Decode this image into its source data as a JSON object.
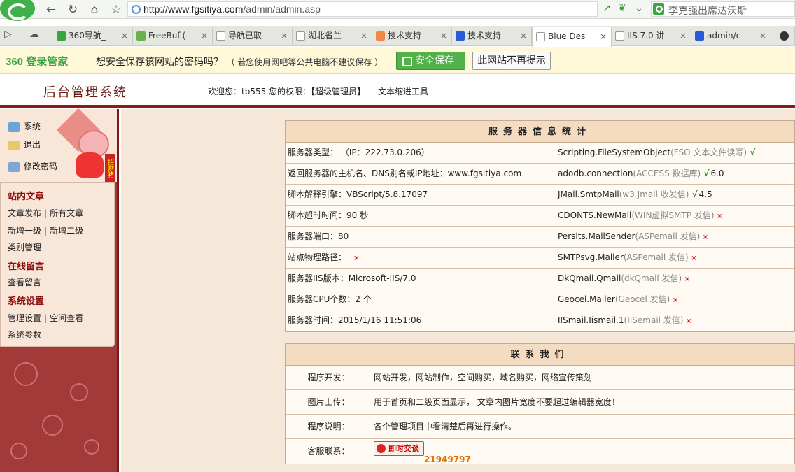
{
  "browser": {
    "url_prefix": "http://www.fgsitiya.com",
    "url_path": "/admin/admin.asp",
    "search_text": "李克强出席达沃斯",
    "tabs": [
      {
        "label": "360导航_",
        "icon_color": "#3aa640"
      },
      {
        "label": "FreeBuf.(",
        "icon_color": "#6ab04c"
      },
      {
        "label": "导航已取",
        "icon_color": "#ffffff"
      },
      {
        "label": "湖北省兰",
        "icon_color": "#ffffff"
      },
      {
        "label": "技术支持",
        "icon_color": "#e84"
      },
      {
        "label": "技术支持",
        "icon_color": "#2a5bd7"
      },
      {
        "label": "Blue Des",
        "icon_color": "#ffffff"
      },
      {
        "label": "IIS 7.0 讲",
        "icon_color": "#ffffff"
      },
      {
        "label": "admin/c",
        "icon_color": "#2a5bd7"
      }
    ]
  },
  "savebar": {
    "logo": "360 登录管家",
    "message": "想安全保存该网站的密码吗？",
    "note": "（ 若您使用网吧等公共电脑不建议保存 ）",
    "save_label": "安全保存",
    "never_label": "此网站不再提示"
  },
  "header": {
    "title": "后台管理系统",
    "welcome": "欢迎您：tb555  您的权限：【超级管理员】",
    "tool": "文本缩进工具"
  },
  "sidebar": {
    "top_links": [
      "系统",
      "退出",
      "修改密码"
    ],
    "pig_tag": "招财猪",
    "sections": [
      {
        "title": "站内文章",
        "items": [
          [
            "文章发布",
            "所有文章"
          ],
          [
            "新增一级",
            "新增二级"
          ],
          [
            "类别管理"
          ]
        ]
      },
      {
        "title": "在线留言",
        "items": [
          [
            "查看留言"
          ]
        ]
      },
      {
        "title": "系统设置",
        "items": [
          [
            "管理设置",
            "空间查看"
          ],
          [
            "系统参数"
          ]
        ]
      }
    ]
  },
  "server_panel": {
    "title": "服务器信息统计",
    "rows": [
      {
        "left": "服务器类型：  （IP：222.73.0.206）",
        "right_main": "Scripting.FileSystemObject",
        "right_note": "(FSO 文本文件读写)",
        "status": "ok",
        "version": ""
      },
      {
        "left": "返回服务器的主机名、DNS别名或IP地址：www.fgsitiya.com",
        "right_main": "adodb.connection",
        "right_note": "(ACCESS 数据库)",
        "status": "ok",
        "version": "6.0"
      },
      {
        "left": "脚本解释引擎：VBScript/5.8.17097",
        "right_main": "JMail.SmtpMail",
        "right_note": "(w3 Jmail 收发信)",
        "status": "ok",
        "version": "4.5"
      },
      {
        "left": "脚本超时时间：90 秒",
        "right_main": "CDONTS.NewMail",
        "right_note": "(WIN虚拟SMTP 发信)",
        "status": "no",
        "version": ""
      },
      {
        "left": "服务器端口：80",
        "right_main": "Persits.MailSender",
        "right_note": "(ASPemail 发信)",
        "status": "no",
        "version": ""
      },
      {
        "left": "站点物理路径：",
        "right_main": "SMTPsvg.Mailer",
        "right_note": "(ASPemail 发信)",
        "status": "no",
        "version": "",
        "left_status": "no"
      },
      {
        "left": "服务器IIS版本：Microsoft-IIS/7.0",
        "right_main": "DkQmail.Qmail",
        "right_note": "(dkQmail 发信)",
        "status": "no",
        "version": ""
      },
      {
        "left": "服务器CPU个数：2 个",
        "right_main": "Geocel.Mailer",
        "right_note": "(Geocel 发信)",
        "status": "no",
        "version": ""
      },
      {
        "left": "服务器时间：2015/1/16 11:51:06",
        "right_main": "IISmail.Iismail.1",
        "right_note": "(IISemail 发信)",
        "status": "no",
        "version": ""
      }
    ]
  },
  "contact_panel": {
    "title": "联系我们",
    "rows": [
      {
        "label": "程序开发：",
        "value": "网站开发，网站制作，空间购买，域名购买，网络宣传策划"
      },
      {
        "label": "图片上传：",
        "value": "用于首页和二级页面显示， 文章内图片宽度不要超过编辑器宽度！"
      },
      {
        "label": "程序说明：",
        "value": "各个管理项目中看清楚后再进行操作。"
      },
      {
        "label": "客服联系：",
        "chat_label": "即时交谈",
        "qq": "21949797"
      }
    ]
  },
  "glyphs": {
    "ok": "√",
    "no": "×"
  }
}
